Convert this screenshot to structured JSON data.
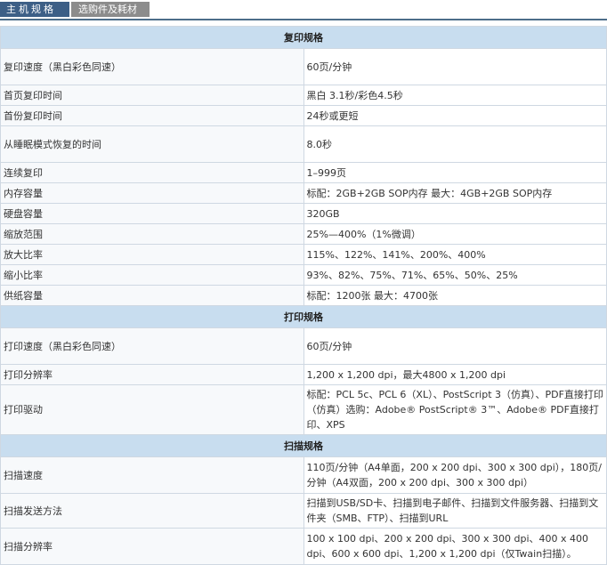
{
  "tabs": {
    "main": "主机规格",
    "options": "选购件及耗材"
  },
  "sections": {
    "copy": "复印规格",
    "print": "打印规格",
    "scan": "扫描规格"
  },
  "copy_rows": [
    {
      "label": "复印速度（黑白彩色同速）",
      "value": "60页/分钟"
    },
    {
      "label": "首页复印时间",
      "value": "黑白 3.1秒/彩色4.5秒"
    },
    {
      "label": "首份复印时间",
      "value": "24秒或更短"
    },
    {
      "label": "从睡眠模式恢复的时间",
      "value": "8.0秒"
    },
    {
      "label": "连续复印",
      "value": "1–999页"
    },
    {
      "label": "内存容量",
      "value": "标配：2GB+2GB SOP内存 最大：4GB+2GB SOP内存"
    },
    {
      "label": "硬盘容量",
      "value": "320GB"
    },
    {
      "label": "缩放范围",
      "value": "25%—400%（1%微调）"
    },
    {
      "label": "放大比率",
      "value": "115%、122%、141%、200%、400%"
    },
    {
      "label": "缩小比率",
      "value": "93%、82%、75%、71%、65%、50%、25%"
    },
    {
      "label": "供纸容量",
      "value": "标配：1200张 最大：4700张"
    }
  ],
  "print_rows": [
    {
      "label": "打印速度（黑白彩色同速）",
      "value": "60页/分钟"
    },
    {
      "label": "打印分辨率",
      "value": "1,200 x 1,200 dpi，最大4800 x 1,200 dpi"
    },
    {
      "label": "打印驱动",
      "value": "标配：PCL 5c、PCL 6（XL）、PostScript 3（仿真）、PDF直接打印（仿真）选购：Adobe® PostScript® 3™、Adobe® PDF直接打印、XPS"
    }
  ],
  "scan_rows": [
    {
      "label": "扫描速度",
      "value": "110页/分钟（A4单面，200 x 200 dpi、300 x 300 dpi），180页/分钟（A4双面，200 x 200 dpi、300 x 300 dpi）"
    },
    {
      "label": "扫描发送方法",
      "value": "扫描到USB/SD卡、扫描到电子邮件、扫描到文件服务器、扫描到文件夹（SMB、FTP）、扫描到URL"
    },
    {
      "label": "扫描分辨率",
      "value": "100 x 100 dpi、200 x 200 dpi、300 x 300 dpi、400 x 400 dpi、600 x 600 dpi、1,200 x 1,200 dpi（仅Twain扫描）。"
    }
  ]
}
